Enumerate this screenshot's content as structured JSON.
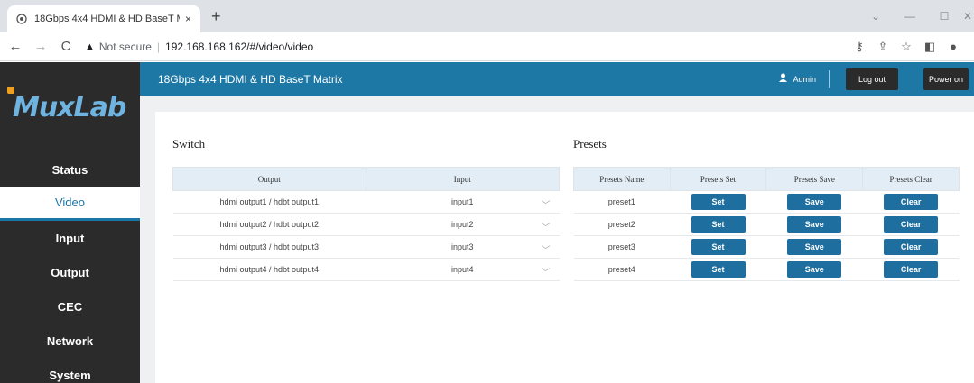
{
  "browser": {
    "tab_title": "18Gbps 4x4 HDMI & HD BaseT M",
    "new_tab": "+",
    "close": "×",
    "security_label": "Not secure",
    "url": "192.168.168.162/#/video/video"
  },
  "app": {
    "logo": "MuxLab",
    "title": "18Gbps 4x4 HDMI & HD BaseT Matrix",
    "user": "Admin",
    "logout": "Log out",
    "power_on": "Power on"
  },
  "sidebar": {
    "items": [
      {
        "label": "Status",
        "active": false
      },
      {
        "label": "Video",
        "active": true
      },
      {
        "label": "Input",
        "active": false
      },
      {
        "label": "Output",
        "active": false
      },
      {
        "label": "CEC",
        "active": false
      },
      {
        "label": "Network",
        "active": false
      },
      {
        "label": "System",
        "active": false
      }
    ]
  },
  "switch": {
    "title": "Switch",
    "headers": [
      "Output",
      "Input"
    ],
    "rows": [
      {
        "output": "hdmi output1 / hdbt output1",
        "input": "input1"
      },
      {
        "output": "hdmi output2 / hdbt output2",
        "input": "input2"
      },
      {
        "output": "hdmi output3 / hdbt output3",
        "input": "input3"
      },
      {
        "output": "hdmi output4 / hdbt output4",
        "input": "input4"
      }
    ]
  },
  "presets": {
    "title": "Presets",
    "headers": [
      "Presets Name",
      "Presets Set",
      "Presets Save",
      "Presets Clear"
    ],
    "rows": [
      {
        "name": "preset1",
        "set": "Set",
        "save": "Save",
        "clear": "Clear"
      },
      {
        "name": "preset2",
        "set": "Set",
        "save": "Save",
        "clear": "Clear"
      },
      {
        "name": "preset3",
        "set": "Set",
        "save": "Save",
        "clear": "Clear"
      },
      {
        "name": "preset4",
        "set": "Set",
        "save": "Save",
        "clear": "Clear"
      }
    ]
  },
  "colors": {
    "header_blue": "#1e78a6",
    "button_blue": "#1e6f9f",
    "sidebar_dark": "#2b2b2b"
  }
}
